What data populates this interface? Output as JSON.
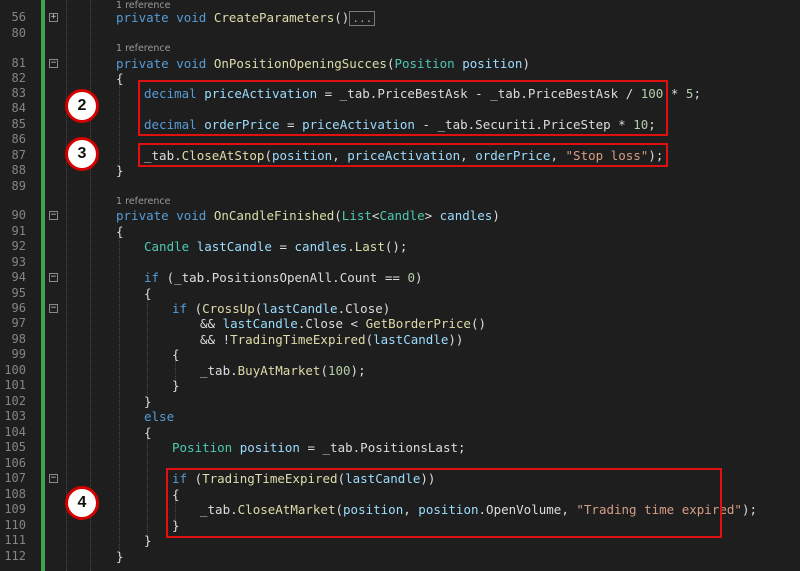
{
  "accent_color": "#e01010",
  "change_bar_color": "#3fa34d",
  "reference_label": "1 reference",
  "collapsed_indicator": "...",
  "line_numbers": [
    "56",
    "80",
    "81",
    "82",
    "83",
    "84",
    "85",
    "86",
    "87",
    "88",
    "89",
    "90",
    "91",
    "92",
    "93",
    "94",
    "95",
    "96",
    "97",
    "98",
    "99",
    "100",
    "101",
    "102",
    "103",
    "104",
    "105",
    "106",
    "107",
    "108",
    "109",
    "110",
    "111",
    "112"
  ],
  "code": {
    "l56": {
      "kw": "private void ",
      "fn": "CreateParameters",
      "p": "()"
    },
    "l81": {
      "kw": "private void ",
      "fn": "OnPositionOpeningSucces",
      "p1": "(",
      "ty": "Position",
      "p2": " ",
      "vr": "position",
      "p3": ")"
    },
    "l82": "{",
    "l83": {
      "kw": "decimal ",
      "vr": "priceActivation",
      "p1": " = _tab.",
      "m1": "PriceBestAsk",
      "p2": " - _tab.",
      "m2": "PriceBestAsk",
      "p3": " / ",
      "n1": "100",
      "p4": " * ",
      "n2": "5",
      "p5": ";"
    },
    "l85": {
      "kw": "decimal ",
      "vr": "orderPrice",
      "p1": " = ",
      "v2": "priceActivation",
      "p2": " - _tab.",
      "m1": "Securiti",
      "p3": ".",
      "m2": "PriceStep",
      "p4": " * ",
      "n1": "10",
      "p5": ";"
    },
    "l87": {
      "p0": "_tab.",
      "fn": "CloseAtStop",
      "p1": "(",
      "v1": "position",
      "p2": ", ",
      "v2": "priceActivation",
      "p3": ", ",
      "v3": "orderPrice",
      "p4": ", ",
      "st": "\"Stop loss\"",
      "p5": ");"
    },
    "l88": "}",
    "l90": {
      "kw": "private void ",
      "fn": "OnCandleFinished",
      "p1": "(",
      "ty1": "List",
      "p2": "<",
      "ty2": "Candle",
      "p3": "> ",
      "vr": "candles",
      "p4": ")"
    },
    "l91": "{",
    "l92": {
      "ty": "Candle ",
      "vr": "lastCandle",
      "p1": " = ",
      "v2": "candles",
      "p2": ".",
      "fn": "Last",
      "p3": "();"
    },
    "l94": {
      "kw": "if ",
      "p1": "(_tab.",
      "m1": "PositionsOpenAll",
      "p2": ".",
      "m2": "Count",
      "p3": " == ",
      "n1": "0",
      "p4": ")"
    },
    "l95": "{",
    "l96": {
      "kw": "if ",
      "p1": "(",
      "fn": "CrossUp",
      "p2": "(",
      "vr": "lastCandle",
      "p3": ".",
      "m1": "Close",
      "p4": ")"
    },
    "l97": {
      "p0": "&& ",
      "vr": "lastCandle",
      "p1": ".",
      "m1": "Close",
      "p2": " < ",
      "fn": "GetBorderPrice",
      "p3": "()"
    },
    "l98": {
      "p0": "&& !",
      "fn": "TradingTimeExpired",
      "p1": "(",
      "vr": "lastCandle",
      "p2": "))"
    },
    "l99": "{",
    "l100": {
      "p0": "_tab.",
      "fn": "BuyAtMarket",
      "p1": "(",
      "n1": "100",
      "p2": ");"
    },
    "l101": "}",
    "l102": "}",
    "l103": "else",
    "l104": "{",
    "l105": {
      "ty": "Position ",
      "vr": "position",
      "p1": " = _tab.",
      "m1": "PositionsLast",
      "p2": ";"
    },
    "l107": {
      "kw": "if ",
      "p1": "(",
      "fn": "TradingTimeExpired",
      "p2": "(",
      "vr": "lastCandle",
      "p3": "))"
    },
    "l108": "{",
    "l109": {
      "p0": "_tab.",
      "fn": "CloseAtMarket",
      "p1": "(",
      "v1": "position",
      "p2": ", ",
      "v2": "position",
      "p3": ".",
      "m1": "OpenVolume",
      "p4": ", ",
      "st": "\"Trading time expired\"",
      "p5": ");"
    },
    "l110": "}",
    "l111": "}",
    "l112": "}"
  },
  "annotations": [
    "2",
    "3",
    "4"
  ]
}
